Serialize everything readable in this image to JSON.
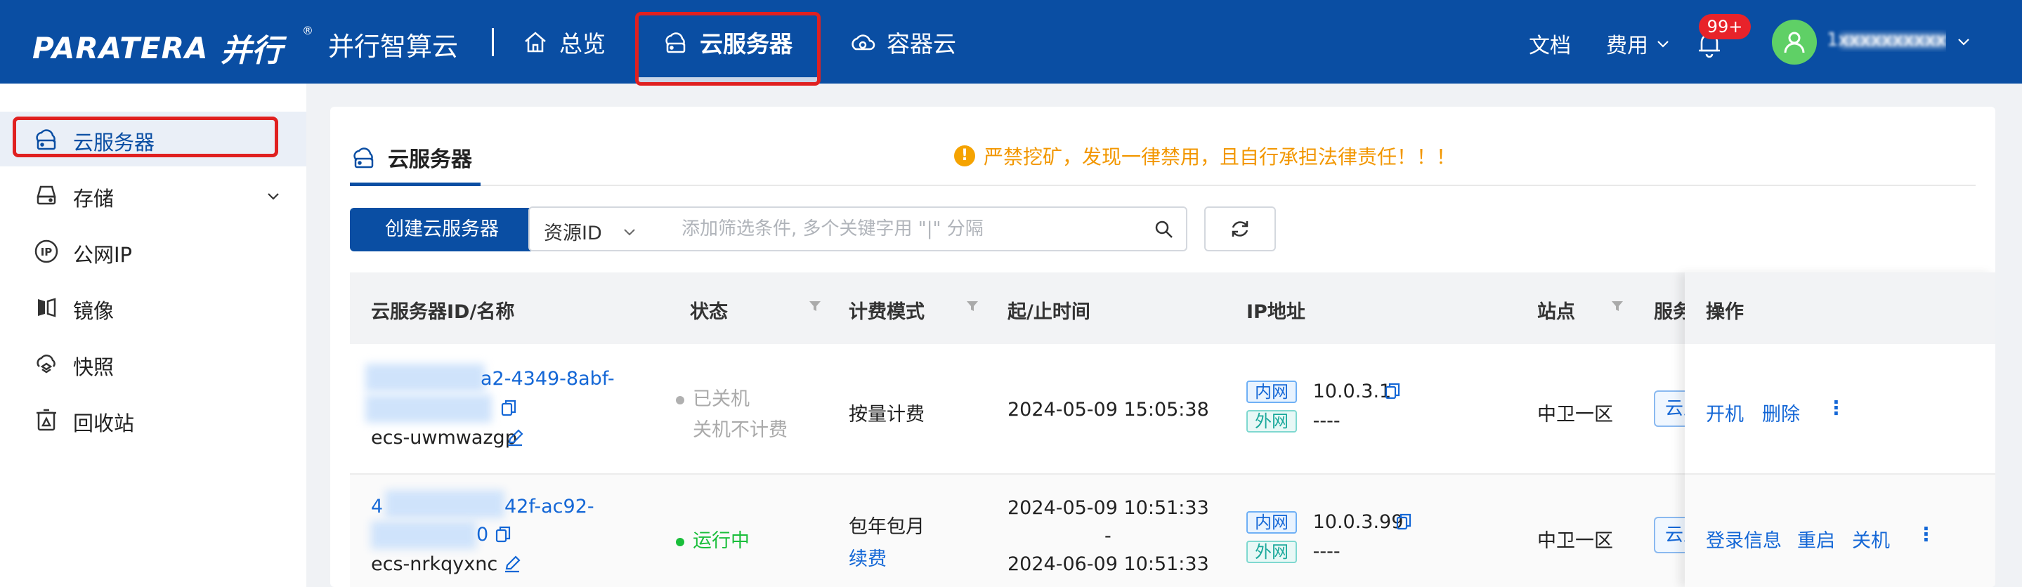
{
  "header": {
    "logo_text": "PARATERA",
    "logo_cn": "并行",
    "logo_reg": "®",
    "product_name": "并行智算云",
    "nav": [
      {
        "label": "总览",
        "icon": "home-icon"
      },
      {
        "label": "云服务器",
        "icon": "cloud-server-icon"
      },
      {
        "label": "容器云",
        "icon": "container-cloud-icon"
      }
    ],
    "docs": "文档",
    "fees": "费用",
    "badge": "99+",
    "username": "1xxxxxxxxxx94"
  },
  "sidebar": {
    "items": [
      {
        "label": "云服务器",
        "icon": "cloud-server-icon"
      },
      {
        "label": "存储",
        "icon": "storage-icon"
      },
      {
        "label": "公网IP",
        "icon": "ip-icon"
      },
      {
        "label": "镜像",
        "icon": "image-icon"
      },
      {
        "label": "快照",
        "icon": "snapshot-icon"
      },
      {
        "label": "回收站",
        "icon": "recycle-icon"
      }
    ]
  },
  "panel": {
    "tab": "云服务器",
    "warning": "严禁挖矿，发现一律禁用，且自行承担法律责任！！！",
    "create_button": "创建云服务器",
    "filter_label": "资源ID",
    "search_placeholder": "添加筛选条件, 多个关键字用 \"|\" 分隔"
  },
  "table": {
    "headers": {
      "id": "云服务器ID/名称",
      "status": "状态",
      "billing": "计费模式",
      "time": "起/止时间",
      "ip": "IP地址",
      "site": "站点",
      "service": "服务",
      "ops": "操作"
    },
    "rows": [
      {
        "id_line1": "a2-4349-8abf-",
        "name": "ecs-uwmwazgp",
        "status": "已关机",
        "status_sub": "关机不计费",
        "status_color": "#b0b0b0",
        "billing": "按量计费",
        "billing_sub": "",
        "start": "2024-05-09 15:05:38",
        "dash": "",
        "end": "",
        "ip_inner_label": "内网",
        "ip_inner": "10.0.3.1",
        "ip_outer_label": "外网",
        "ip_outer": "----",
        "site": "中卫一区",
        "service_tag": "云主",
        "ops": [
          "开机",
          "删除"
        ]
      },
      {
        "id_line1": "4",
        "id_line1b": "42f-ac92-",
        "id_line2": "0",
        "name": "ecs-nrkqyxnc",
        "status": "运行中",
        "status_color": "#19be3a",
        "billing": "包年包月",
        "billing_sub": "续费",
        "start": "2024-05-09 10:51:33",
        "dash": "-",
        "end": "2024-06-09 10:51:33",
        "ip_inner_label": "内网",
        "ip_inner": "10.0.3.99",
        "ip_outer_label": "外网",
        "ip_outer": "----",
        "site": "中卫一区",
        "service_tag": "云主",
        "ops": [
          "登录信息",
          "重启",
          "关机"
        ]
      }
    ],
    "more": "⋮"
  }
}
